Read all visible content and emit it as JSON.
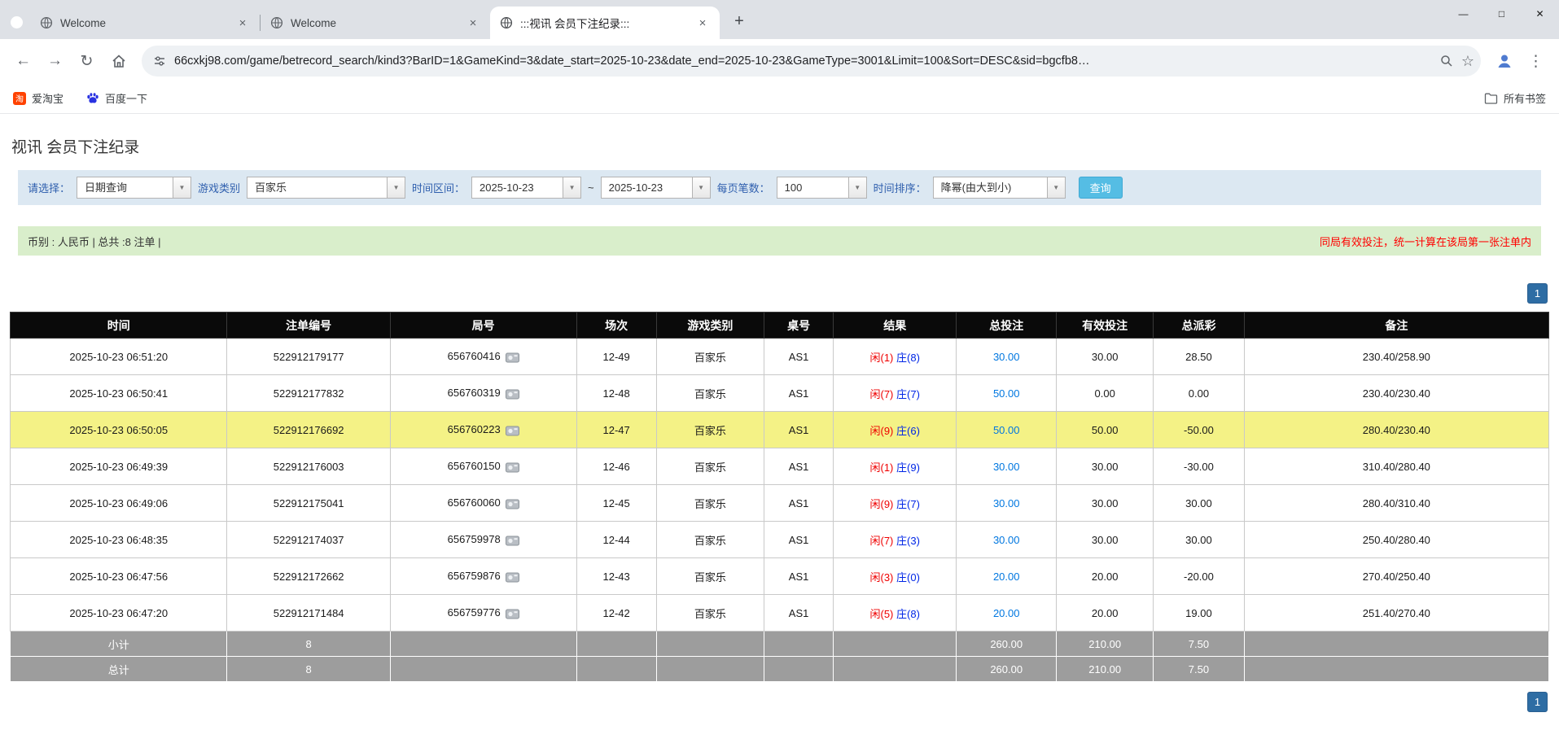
{
  "icons": {
    "back": "←",
    "forward": "→",
    "reload": "↻",
    "star": "☆",
    "kebab": "⋮",
    "minimize": "—",
    "maximize": "□",
    "close": "✕",
    "tab_close": "×",
    "new_tab": "+",
    "dropdown": "▼",
    "taobao_glyph": "淘"
  },
  "browser": {
    "tabs": [
      {
        "title": "Welcome"
      },
      {
        "title": "Welcome"
      },
      {
        "title": ":::视讯 会员下注纪录:::"
      }
    ],
    "url": "66cxkj98.com/game/betrecord_search/kind3?BarID=1&GameKind=3&date_start=2025-10-23&date_end=2025-10-23&GameType=3001&Limit=100&Sort=DESC&sid=bgcfb8…",
    "bookmarks": {
      "taobao": "爱淘宝",
      "baidu": "百度一下",
      "all_bookmarks": "所有书签"
    }
  },
  "page": {
    "title": "视讯 会员下注纪录",
    "filters": {
      "select_label": "请选择：",
      "select_value": "日期查询",
      "game_label": "游戏类别",
      "game_value": "百家乐",
      "range_label": "时间区间：",
      "date_start": "2025-10-23",
      "tilde": "~",
      "date_end": "2025-10-23",
      "pagesize_label": "每页笔数：",
      "pagesize_value": "100",
      "sort_label": "时间排序：",
      "sort_value": "降幂(由大到小)",
      "search_button": "查询"
    },
    "summary_left": "币别 : 人民币 | 总共 :8 注单 |",
    "summary_right": "同局有效投注，统一计算在该局第一张注单内",
    "pagination": "1",
    "colors": {
      "player_red": "#ef0000",
      "banker_blue": "#0026e6",
      "bet_link_blue": "#0077e0",
      "negative_red": "#ff0000",
      "highlight_yellow": "#f4f286",
      "header_black": "#0a0a0a",
      "footer_gray": "#9d9d9d",
      "search_button_blue": "#55bde4",
      "pager_blue": "#2e6da4",
      "filterbar_bg": "#dce8f2",
      "summary_bg": "#d9eecb"
    },
    "table": {
      "headers": [
        "时间",
        "注单编号",
        "局号",
        "场次",
        "游戏类别",
        "桌号",
        "结果",
        "总投注",
        "有效投注",
        "总派彩",
        "备注"
      ],
      "rows": [
        {
          "time": "2025-10-23 06:51:20",
          "bet_id": "522912179177",
          "round_id": "656760416",
          "session": "12-49",
          "game": "百家乐",
          "table_no": "AS1",
          "player": "闲(1)",
          "banker": "庄(8)",
          "total_bet": "30.00",
          "valid_bet": "30.00",
          "payout": "28.50",
          "remark": "230.40/258.90",
          "highlighted": false
        },
        {
          "time": "2025-10-23 06:50:41",
          "bet_id": "522912177832",
          "round_id": "656760319",
          "session": "12-48",
          "game": "百家乐",
          "table_no": "AS1",
          "player": "闲(7)",
          "banker": "庄(7)",
          "total_bet": "50.00",
          "valid_bet": "0.00",
          "payout": "0.00",
          "remark": "230.40/230.40",
          "highlighted": false
        },
        {
          "time": "2025-10-23 06:50:05",
          "bet_id": "522912176692",
          "round_id": "656760223",
          "session": "12-47",
          "game": "百家乐",
          "table_no": "AS1",
          "player": "闲(9)",
          "banker": "庄(6)",
          "total_bet": "50.00",
          "valid_bet": "50.00",
          "payout": "-50.00",
          "remark": "280.40/230.40",
          "highlighted": true
        },
        {
          "time": "2025-10-23 06:49:39",
          "bet_id": "522912176003",
          "round_id": "656760150",
          "session": "12-46",
          "game": "百家乐",
          "table_no": "AS1",
          "player": "闲(1)",
          "banker": "庄(9)",
          "total_bet": "30.00",
          "valid_bet": "30.00",
          "payout": "-30.00",
          "remark": "310.40/280.40",
          "highlighted": false
        },
        {
          "time": "2025-10-23 06:49:06",
          "bet_id": "522912175041",
          "round_id": "656760060",
          "session": "12-45",
          "game": "百家乐",
          "table_no": "AS1",
          "player": "闲(9)",
          "banker": "庄(7)",
          "total_bet": "30.00",
          "valid_bet": "30.00",
          "payout": "30.00",
          "remark": "280.40/310.40",
          "highlighted": false
        },
        {
          "time": "2025-10-23 06:48:35",
          "bet_id": "522912174037",
          "round_id": "656759978",
          "session": "12-44",
          "game": "百家乐",
          "table_no": "AS1",
          "player": "闲(7)",
          "banker": "庄(3)",
          "total_bet": "30.00",
          "valid_bet": "30.00",
          "payout": "30.00",
          "remark": "250.40/280.40",
          "highlighted": false
        },
        {
          "time": "2025-10-23 06:47:56",
          "bet_id": "522912172662",
          "round_id": "656759876",
          "session": "12-43",
          "game": "百家乐",
          "table_no": "AS1",
          "player": "闲(3)",
          "banker": "庄(0)",
          "total_bet": "20.00",
          "valid_bet": "20.00",
          "payout": "-20.00",
          "remark": "270.40/250.40",
          "highlighted": false
        },
        {
          "time": "2025-10-23 06:47:20",
          "bet_id": "522912171484",
          "round_id": "656759776",
          "session": "12-42",
          "game": "百家乐",
          "table_no": "AS1",
          "player": "闲(5)",
          "banker": "庄(8)",
          "total_bet": "20.00",
          "valid_bet": "20.00",
          "payout": "19.00",
          "remark": "251.40/270.40",
          "highlighted": false
        }
      ],
      "subtotal": {
        "label": "小计",
        "count": "8",
        "total_bet": "260.00",
        "valid_bet": "210.00",
        "payout": "7.50"
      },
      "total": {
        "label": "总计",
        "count": "8",
        "total_bet": "260.00",
        "valid_bet": "210.00",
        "payout": "7.50"
      }
    }
  }
}
